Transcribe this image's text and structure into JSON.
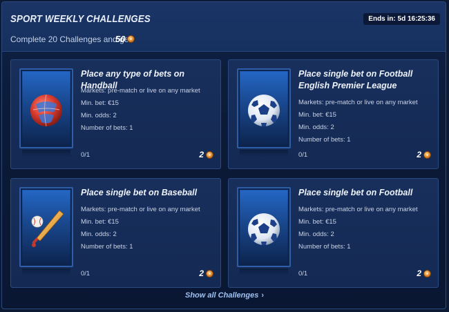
{
  "header": {
    "title": "SPORT WEEKLY CHALLENGES",
    "subtitle": "Complete 20 Challenges and get",
    "reward": "50",
    "ends_label": "Ends in: 5d 16:25:36"
  },
  "challenges": [
    {
      "title": "Place any type of bets on Handball",
      "markets": "Markets:  pre-match or live on any market",
      "min_bet": "Min. bet: €15",
      "min_odds": "Min. odds: 2",
      "num_bets": "Number of bets: 1",
      "progress": "0/1",
      "reward": "2",
      "icon": "handball-icon"
    },
    {
      "title": "Place single bet on Football English Premier League",
      "markets": "Markets:  pre-match or live on any market",
      "min_bet": "Min. bet: €15",
      "min_odds": "Min. odds: 2",
      "num_bets": "Number of bets: 1",
      "progress": "0/1",
      "reward": "2",
      "icon": "football-icon"
    },
    {
      "title": "Place single bet on Baseball",
      "markets": "Markets:  pre-match or live on any market",
      "min_bet": "Min. bet: €15",
      "min_odds": "Min. odds: 2",
      "num_bets": "Number of bets: 1",
      "progress": "0/1",
      "reward": "2",
      "icon": "baseball-icon"
    },
    {
      "title": "Place single bet on Football",
      "markets": "Markets:  pre-match or live on any market",
      "min_bet": "Min. bet: €15",
      "min_odds": "Min. odds: 2",
      "num_bets": "Number of bets: 1",
      "progress": "0/1",
      "reward": "2",
      "icon": "football-icon"
    }
  ],
  "footer": {
    "show_all": "Show all Challenges"
  },
  "colors": {
    "background": "#0d1a33",
    "card": "#182f5c",
    "accent_link": "#9fc3f2",
    "coin": "#e08a2a"
  }
}
